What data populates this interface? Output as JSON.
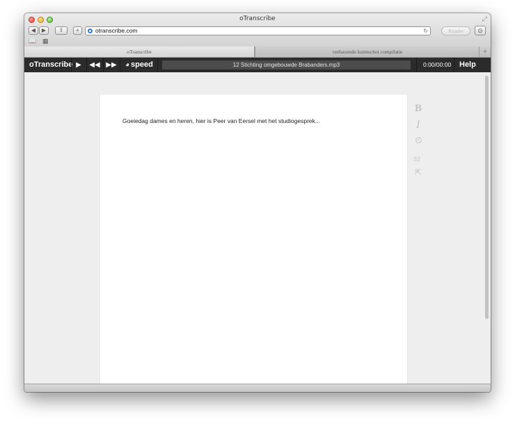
{
  "window": {
    "title": "oTranscribe"
  },
  "browser": {
    "url": "otranscribe.com",
    "reader_label": "Reader",
    "tabs": [
      {
        "label": "oTranscribe",
        "active": true
      },
      {
        "label": "verbazende kuimschot compilatie",
        "active": false
      }
    ],
    "new_tab_label": "+",
    "add_label": "+"
  },
  "app": {
    "name": "oTranscribe",
    "controls": {
      "play_icon": "play-icon",
      "rewind_icon": "rewind-icon",
      "forward_icon": "fast-forward-icon"
    },
    "speed_label": "speed",
    "file_name": "12 Stichting omgebouwde Brabanders.mp3",
    "time": "0:00/00:00",
    "help_label": "Help"
  },
  "editor": {
    "text": "Goeiedag dames en heren, hier is Peer van Eersel met het studiogesprek...",
    "word_count": "32",
    "bold_label": "B",
    "italic_label": "I"
  }
}
